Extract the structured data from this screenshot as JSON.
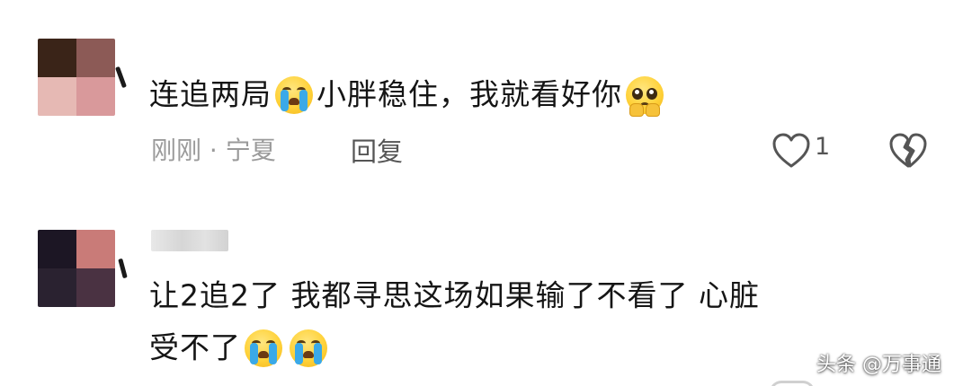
{
  "comments": [
    {
      "avatar_colors": [
        "#3a2418",
        "#8c5a56",
        "#e6b9b4",
        "#d9999b"
      ],
      "text_parts": [
        "连追两局",
        "小胖稳住，我就看好你"
      ],
      "emojis": [
        "loudly-crying-face",
        "pleading-face"
      ],
      "time": "刚刚",
      "separator": "·",
      "location": "宁夏",
      "reply_label": "回复",
      "like_count": "1"
    },
    {
      "avatar_colors": [
        "#1c1624",
        "#c97b78",
        "#2a2230",
        "#4a3242"
      ],
      "line1": "让2追2了 我都寻思这场如果输了不看了 心脏",
      "line2": "受不了",
      "emojis": [
        "loudly-crying-face",
        "loudly-crying-face"
      ]
    }
  ],
  "watermark": "头条 @万事通",
  "colors": {
    "text": "#151515",
    "meta": "#9a9a9a",
    "icon": "#555555",
    "tear": "#3aa9e8",
    "emoji_face": "#ffd23a"
  }
}
